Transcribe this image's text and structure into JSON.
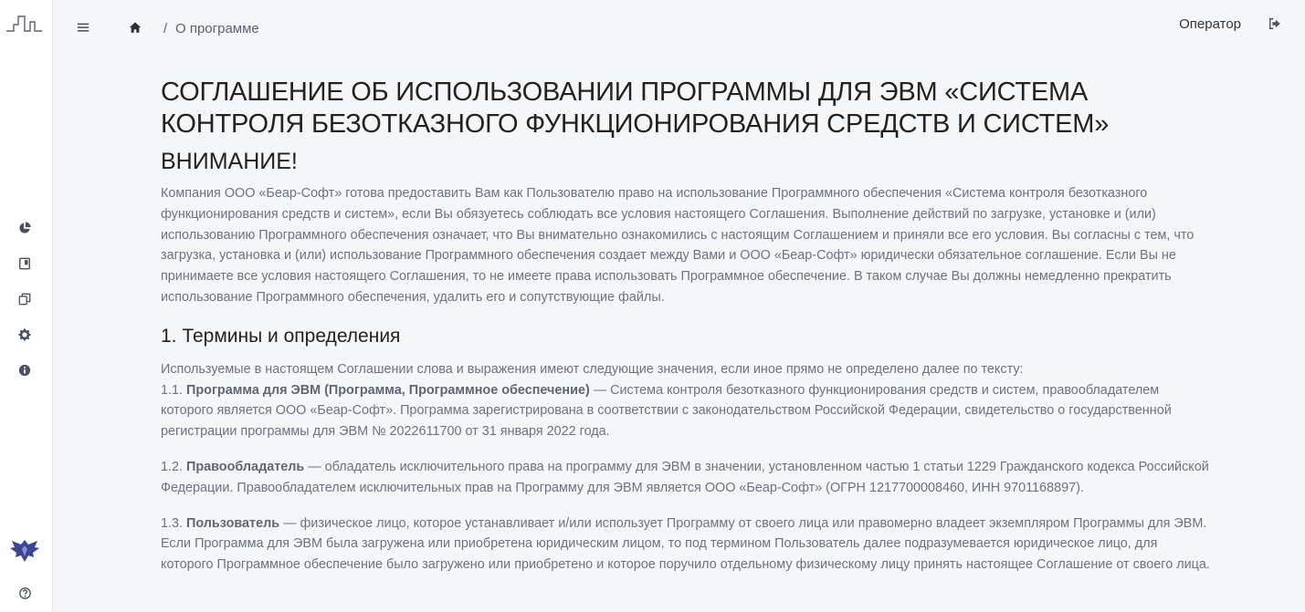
{
  "breadcrumb": {
    "current": "О программе",
    "separator": "/"
  },
  "header": {
    "user": "Оператор"
  },
  "sidebar": {
    "icons": [
      "chart-pie-icon",
      "book-icon",
      "copy-icon",
      "gear-icon",
      "info-icon",
      "help-icon"
    ]
  },
  "doc": {
    "title": "СОГЛАШЕНИЕ ОБ ИСПОЛЬЗОВАНИИ ПРОГРАММЫ ДЛЯ ЭВМ «СИСТЕМА КОНТРОЛЯ БЕЗОТКАЗНОГО ФУНКЦИОНИРОВАНИЯ СРЕДСТВ И СИСТЕМ»",
    "attention": "ВНИМАНИЕ!",
    "intro": "Компания ООО «Беар-Софт» готова предоставить Вам как Пользователю право на использование Программного обеспечения «Система контроля безотказного функционирования средств и систем», если Вы обязуетесь соблюдать все условия настоящего Соглашения. Выполнение действий по загрузке, установке и (или) использованию Программного обеспечения означает, что Вы внимательно ознакомились с настоящим Соглашением и приняли все его условия. Вы согласны с тем, что загрузка, установка и (или) использование Программного обеспечения создает между Вами и ООО «Беар-Софт» юридически обязательное соглашение. Если Вы не принимаете все условия настоящего Соглашения, то не имеете права использовать Программное обеспечение. В таком случае Вы должны немедленно прекратить использование Программного обеспечения, удалить его и сопутствующие файлы.",
    "section1_title": "1. Термины и определения",
    "section1_intro": "Используемые в настоящем Соглашении слова и выражения имеют следующие значения, если иное прямо не определено далее по тексту:",
    "terms": [
      {
        "num": "1.1.",
        "term": "Программа для ЭВМ (Программа, Программное обеспечение)",
        "text": " — Система контроля безотказного функционирования средств и систем, правообладателем которого является ООО «Беар-Софт». Программа зарегистрирована в соответствии с законодательством Российской Федерации, свидетельство о государственной регистрации программы для ЭВМ № 2022611700 от 31 января 2022 года."
      },
      {
        "num": "1.2.",
        "term": "Правообладатель",
        "text": " — обладатель исключительного права на программу для ЭВМ в значении, установленном частью 1 статьи 1229 Гражданского кодекса Российской Федерации. Правообладателем исключительных прав на Программу для ЭВМ является ООО «Беар-Софт» (ОГРН 1217700008460, ИНН 9701168897)."
      },
      {
        "num": "1.3.",
        "term": "Пользователь",
        "text": " — физическое лицо, которое устанавливает и/или использует Программу от своего лица или правомерно владеет экземпляром Программы для ЭВМ. Если Программа для ЭВМ была загружена или приобретена юридическим лицом, то под термином Пользователь далее подразумевается юридическое лицо, для которого Программное обеспечение было загружено или приобретено и которое поручило отдельному физическому лицу принять настоящее Соглашение от своего лица."
      }
    ]
  },
  "colors": {
    "background": "#f5f6f8",
    "sidebar": "#ffffff",
    "text": "#6b7280",
    "heading": "#222222",
    "icon": "#4a5261",
    "brand": "#3d4494"
  }
}
